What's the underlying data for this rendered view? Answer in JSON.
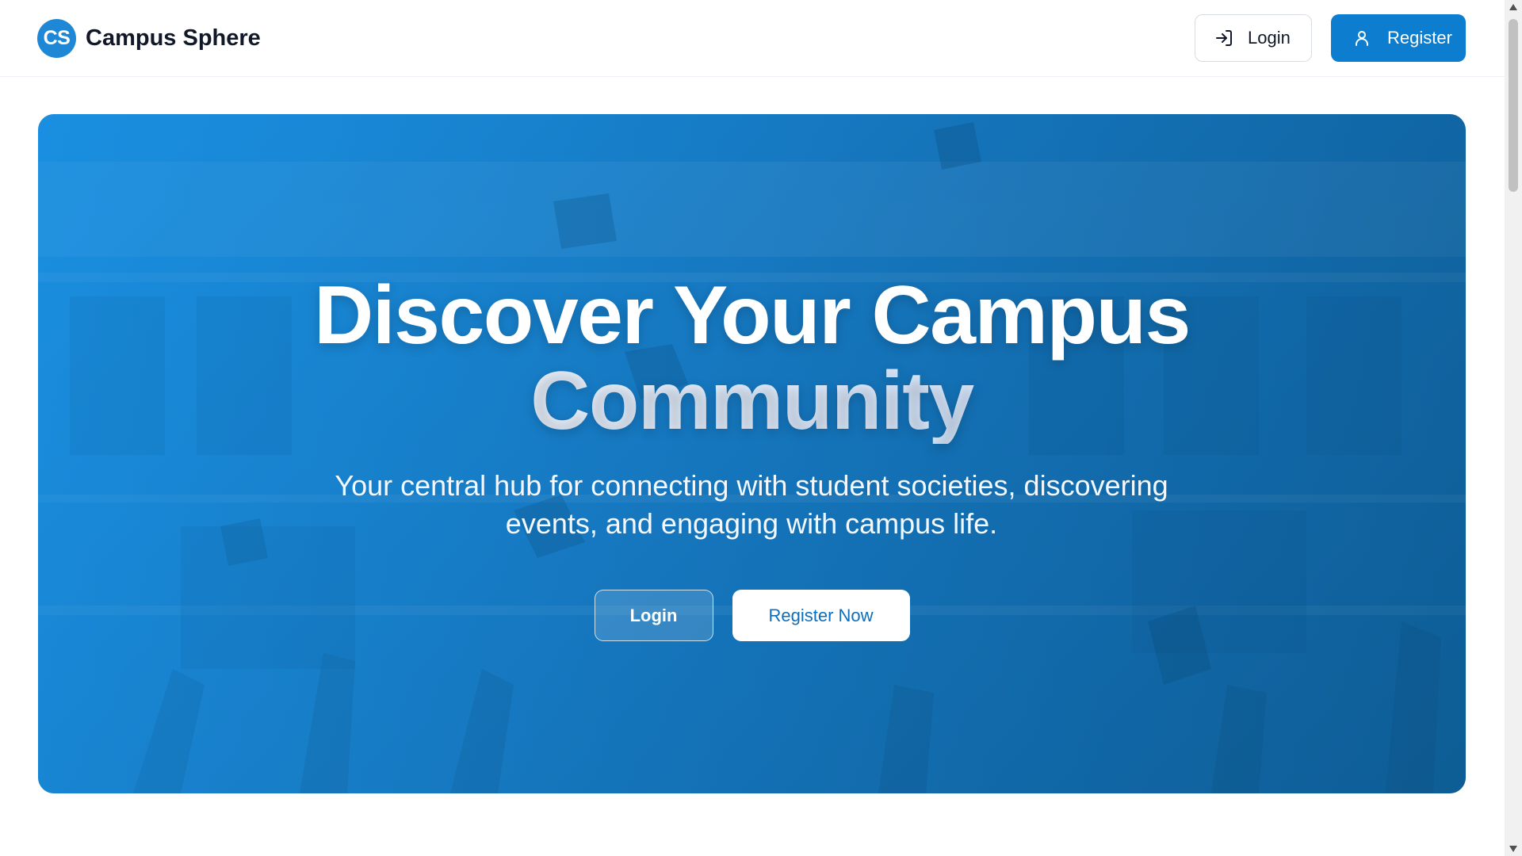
{
  "header": {
    "brand": {
      "logo_text": "CS",
      "name": "Campus Sphere"
    },
    "login_label": "Login",
    "register_label": "Register",
    "icons": {
      "login": "login-arrow-icon",
      "register": "user-icon"
    }
  },
  "hero": {
    "title_line1": "Discover Your Campus",
    "title_line2": "Community",
    "subtitle": "Your central hub for connecting with student societies, discovering events, and engaging with campus life.",
    "login_label": "Login",
    "register_label": "Register Now"
  },
  "colors": {
    "primary": "#0d7dd0",
    "logo": "#1e88d6",
    "hero_gradient_start": "#1a8fe0",
    "hero_gradient_end": "#0f5f99",
    "text_dark": "#111827"
  }
}
